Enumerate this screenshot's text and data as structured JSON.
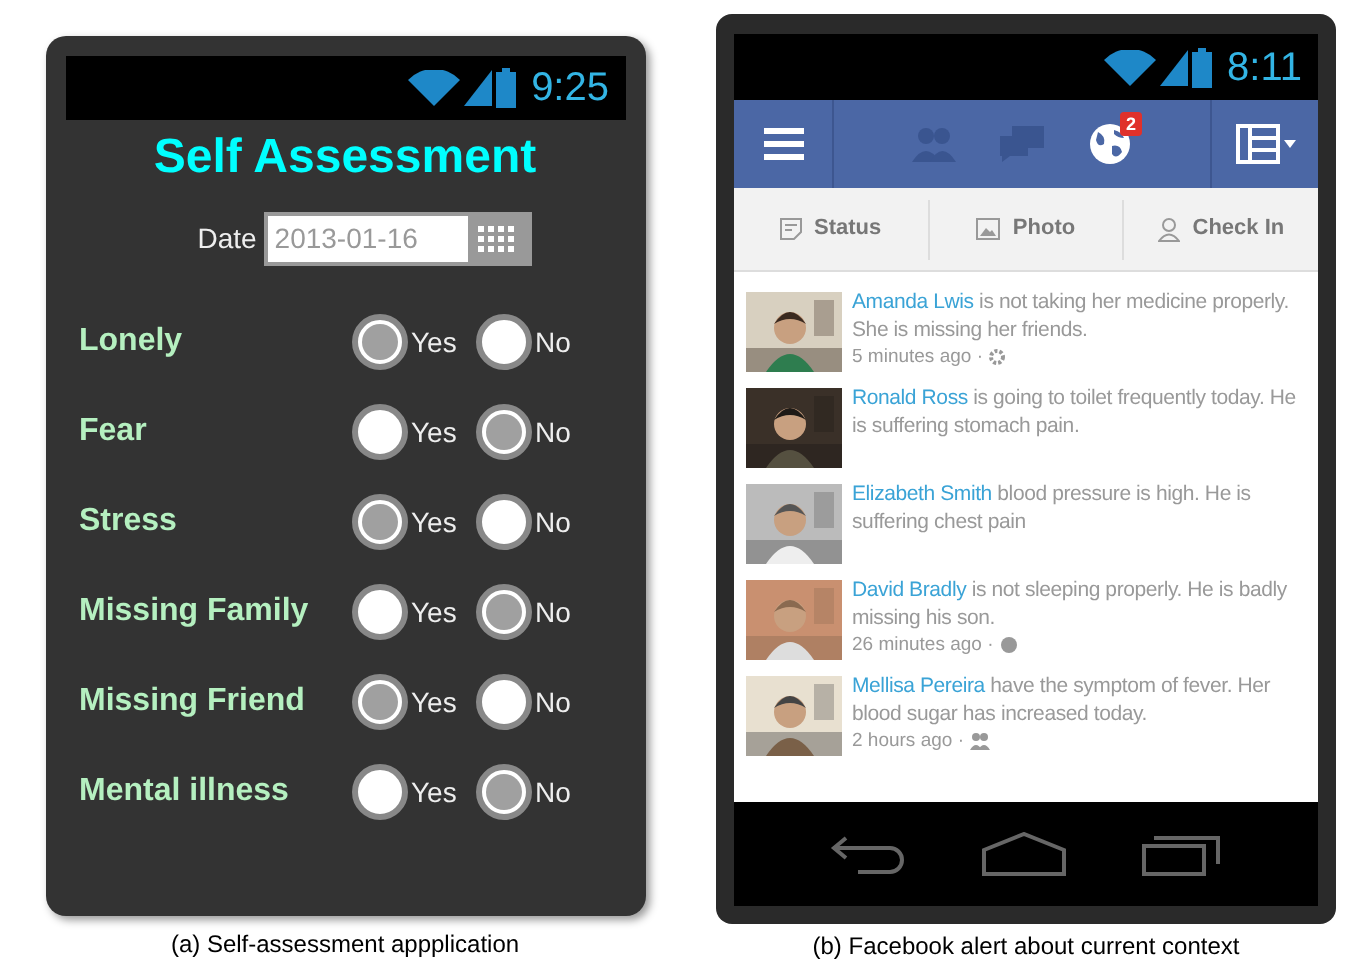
{
  "left_phone": {
    "status_bar": {
      "time": "9:25"
    },
    "title": "Self Assessment",
    "date": {
      "label": "Date",
      "value": "2013-01-16"
    },
    "questions": [
      {
        "label": "Lonely",
        "options": [
          {
            "label": "Yes",
            "selected": true
          },
          {
            "label": "No",
            "selected": false
          }
        ]
      },
      {
        "label": "Fear",
        "options": [
          {
            "label": "Yes",
            "selected": false
          },
          {
            "label": "No",
            "selected": true
          }
        ]
      },
      {
        "label": "Stress",
        "options": [
          {
            "label": "Yes",
            "selected": true
          },
          {
            "label": "No",
            "selected": false
          }
        ]
      },
      {
        "label": "Missing Family",
        "options": [
          {
            "label": "Yes",
            "selected": false
          },
          {
            "label": "No",
            "selected": true
          }
        ]
      },
      {
        "label": "Missing Friend",
        "options": [
          {
            "label": "Yes",
            "selected": true
          },
          {
            "label": "No",
            "selected": false
          }
        ]
      },
      {
        "label": "Mental illness",
        "options": [
          {
            "label": "Yes",
            "selected": false
          },
          {
            "label": "No",
            "selected": true
          }
        ]
      }
    ],
    "caption": "(a) Self-assessment appplication"
  },
  "right_phone": {
    "status_bar": {
      "time": "8:11"
    },
    "notification_badge": "2",
    "tabs": [
      "Status",
      "Photo",
      "Check In"
    ],
    "posts": [
      {
        "name": "Amanda Lwis",
        "text": "is not taking her medicine properly. She is missing her friends.",
        "time": "5 minutes ago ·"
      },
      {
        "name": "Ronald Ross",
        "text": "is going to toilet frequently today. He is suffering stomach pain."
      },
      {
        "name": "Elizabeth Smith",
        "text": "blood pressure is high. He is suffering chest pain"
      },
      {
        "name": "David Bradly",
        "text": "is not sleeping properly. He is badly missing his son.",
        "time": "26 minutes ago ·"
      },
      {
        "name": "Mellisa Pereira",
        "text": "have the symptom of fever. Her blood sugar has increased today.",
        "time": "2 hours ago ·"
      }
    ],
    "caption": "(b) Facebook alert about current context"
  }
}
